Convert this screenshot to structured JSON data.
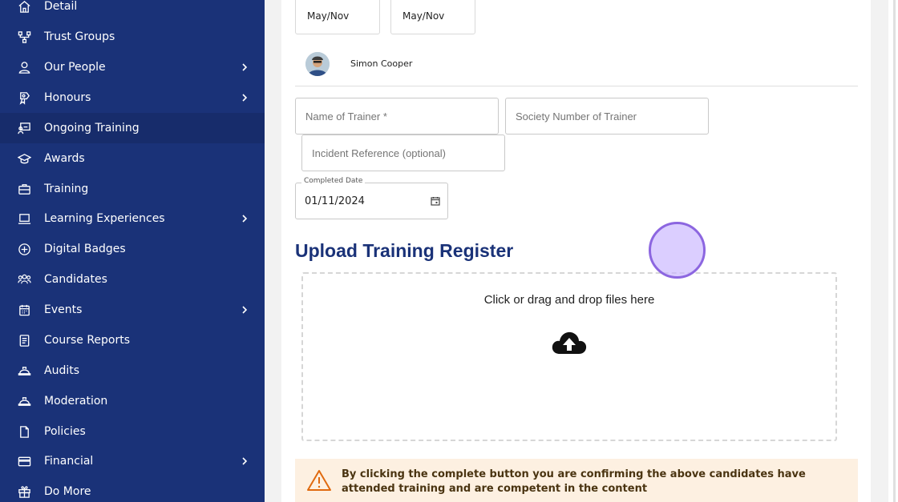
{
  "sidebar": {
    "items": [
      {
        "label": "Detail",
        "icon": "home-icon",
        "chevron": false,
        "active": false
      },
      {
        "label": "Trust Groups",
        "icon": "hierarchy-icon",
        "chevron": false,
        "active": false
      },
      {
        "label": "Our People",
        "icon": "person-icon",
        "chevron": true,
        "active": false
      },
      {
        "label": "Honours",
        "icon": "award-ribbon-icon",
        "chevron": true,
        "active": false
      },
      {
        "label": "Ongoing Training",
        "icon": "presentation-icon",
        "chevron": false,
        "active": true
      },
      {
        "label": "Awards",
        "icon": "graduation-cap-icon",
        "chevron": false,
        "active": false
      },
      {
        "label": "Training",
        "icon": "briefcase-icon",
        "chevron": false,
        "active": false
      },
      {
        "label": "Learning Experiences",
        "icon": "laptop-icon",
        "chevron": true,
        "active": false
      },
      {
        "label": "Digital Badges",
        "icon": "badge-plus-icon",
        "chevron": false,
        "active": false
      },
      {
        "label": "Candidates",
        "icon": "group-icon",
        "chevron": false,
        "active": false
      },
      {
        "label": "Events",
        "icon": "calendar-icon",
        "chevron": true,
        "active": false
      },
      {
        "label": "Course Reports",
        "icon": "report-icon",
        "chevron": false,
        "active": false
      },
      {
        "label": "Audits",
        "icon": "hard-hat-icon",
        "chevron": false,
        "active": false
      },
      {
        "label": "Moderation",
        "icon": "hard-hat-icon",
        "chevron": false,
        "active": false
      },
      {
        "label": "Policies",
        "icon": "document-icon",
        "chevron": false,
        "active": false
      },
      {
        "label": "Financial",
        "icon": "credit-card-icon",
        "chevron": true,
        "active": false
      },
      {
        "label": "Do More",
        "icon": "gift-icon",
        "chevron": false,
        "active": false
      }
    ]
  },
  "top_boxes": [
    "May/Nov",
    "May/Nov"
  ],
  "person": {
    "name": "Simon Cooper"
  },
  "form": {
    "trainer_name_placeholder": "Name of Trainer *",
    "society_number_placeholder": "Society Number of Trainer",
    "incident_reference_placeholder": "Incident Reference (optional)",
    "completed_date_label": "Completed Date",
    "completed_date_value": "01/11/2024"
  },
  "upload": {
    "title": "Upload Training Register",
    "drop_text": "Click or drag and drop files here"
  },
  "warning": {
    "text": "By clicking the complete button you are confirming the above candidates have attended training and are competent in the content"
  },
  "colors": {
    "sidebar_bg": "#1a3278",
    "sidebar_active": "#172c6b",
    "title_blue": "#1a3278",
    "warning_bg": "#fdf0e1"
  }
}
